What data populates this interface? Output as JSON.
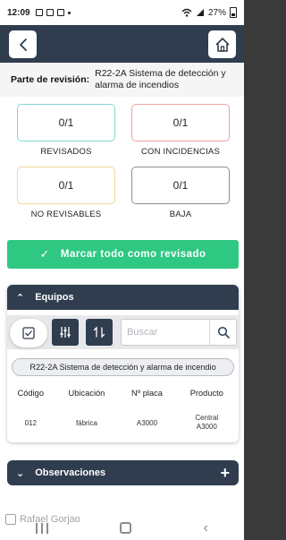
{
  "status_bar": {
    "time": "12:09",
    "battery": "27%"
  },
  "header": {
    "back_icon": "chevron-left-icon",
    "home_icon": "home-icon"
  },
  "info": {
    "label": "Parte de revisión:",
    "value": "R22-2A Sistema de detección y alarma de incendios"
  },
  "counters": [
    {
      "value": "0/1",
      "label": "REVISADOS",
      "color": "#7fd9cf"
    },
    {
      "value": "0/1",
      "label": "CON INCIDENCIAS",
      "color": "#f0a0a0"
    },
    {
      "value": "0/1",
      "label": "NO REVISABLES",
      "color": "#f2d89a"
    },
    {
      "value": "0/1",
      "label": "BAJA",
      "color": "#8a8d93"
    }
  ],
  "mark_all": {
    "label": "Marcar todo como revisado",
    "color": "#2fc882"
  },
  "equipos": {
    "title": "Equipos",
    "search_placeholder": "Buscar",
    "filter_chip": "R22-2A Sistema de detección y alarma de incendio",
    "columns": [
      "Código",
      "Ubicación",
      "Nº placa",
      "Producto"
    ],
    "rows": [
      {
        "codigo": "012",
        "ubicacion": "fábrica",
        "placa": "A3000",
        "producto": "Central A3000"
      }
    ]
  },
  "observaciones": {
    "title": "Observaciones"
  },
  "watermark": "Rafael Gorjao",
  "colors": {
    "primary": "#2f3d4f",
    "accent": "#2fc882"
  }
}
